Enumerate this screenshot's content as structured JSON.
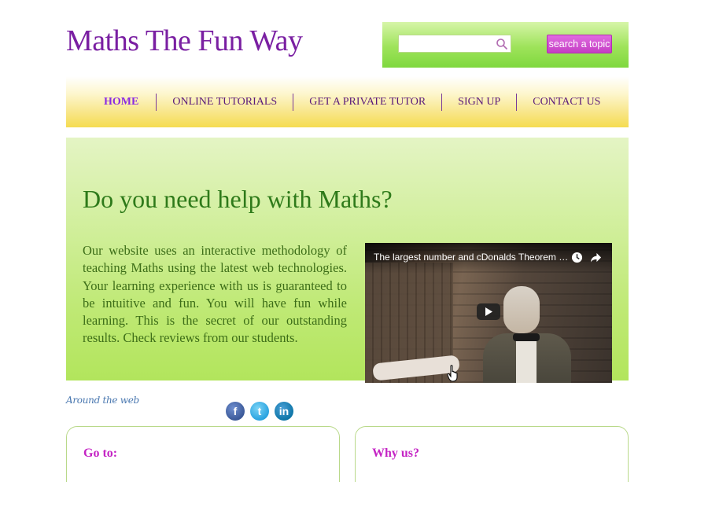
{
  "header": {
    "logo": "Maths The Fun Way"
  },
  "search": {
    "value": "",
    "placeholder": "",
    "button_label": "search a topic"
  },
  "nav": {
    "items": [
      {
        "label": "HOME",
        "active": true
      },
      {
        "label": "ONLINE TUTORIALS",
        "active": false
      },
      {
        "label": "GET A PRIVATE TUTOR",
        "active": false
      },
      {
        "label": "SIGN UP",
        "active": false
      },
      {
        "label": "CONTACT US",
        "active": false
      }
    ]
  },
  "hero": {
    "title": "Do you need help with Maths?",
    "text": "Our website uses an interactive methodology of teaching Maths using the latest web technologies. Your learning experience with us is guaranteed to be intuitive and fun. You will have fun while learning. This is the secret of our outstanding results. Check reviews from our students."
  },
  "video": {
    "title": "The largest number and cDonalds Theorem - ...",
    "icons": [
      "watch-later-icon",
      "share-icon",
      "play-icon"
    ]
  },
  "social": {
    "label": "Around the web",
    "networks": [
      "facebook-icon",
      "twitter-icon",
      "linkedin-icon"
    ]
  },
  "boxes": {
    "goto_title": "Go to:",
    "why_title": "Why us?"
  },
  "colors": {
    "logo": "#7a1fa2",
    "nav_text": "#5a1a7a",
    "hero_title": "#2e7a1a",
    "hero_text": "#3d6e18",
    "box_title": "#c424c4",
    "search_button": "#c43ec4"
  }
}
